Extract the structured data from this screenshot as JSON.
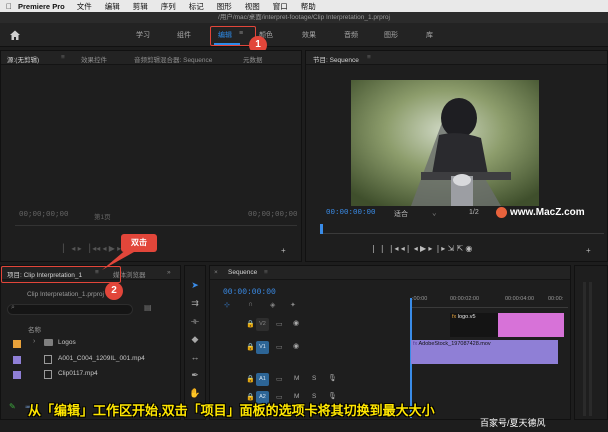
{
  "menubar": {
    "app": "Premiere Pro",
    "items": [
      "文件",
      "编辑",
      "剪辑",
      "序列",
      "标记",
      "图形",
      "视图",
      "窗口",
      "帮助"
    ]
  },
  "window": {
    "path": "/用户/mac/桌面/interpret-footage/Clip Interpretation_1.prproj"
  },
  "workspaces": {
    "items": [
      "学习",
      "组件",
      "编辑",
      "颜色",
      "效果",
      "音频",
      "图形",
      "库"
    ],
    "active": "编辑"
  },
  "source_panel": {
    "tabs": [
      "源:(无剪辑)",
      "效果控件",
      "音频剪辑混合器: Sequence",
      "元数据"
    ],
    "timecode_left": "00;00;00;00",
    "page": "第1页",
    "timecode_right": "00;00;00;00"
  },
  "program_panel": {
    "title": "节目: Sequence",
    "timecode": "00:00:00:00",
    "fit": "适合",
    "resolution": "1/2",
    "timecode_right": "00:00:05:00"
  },
  "project_panel": {
    "tab": "项目: Clip Interpretation_1",
    "tab2": "媒体浏览器",
    "file": "Clip Interpretation_1.prproj",
    "col_name": "名称",
    "items": [
      {
        "name": "Logos",
        "color": "#e8a13a",
        "type": "folder"
      },
      {
        "name": "A001_C004_1209IL_001.mp4",
        "color": "#8f7fd6",
        "type": "clip"
      },
      {
        "name": "Clip0117.mp4",
        "color": "#8f7fd6",
        "type": "clip"
      }
    ]
  },
  "timeline": {
    "tab": "Sequence",
    "timecode": "00:00:00:00",
    "ruler": [
      ":00:00",
      "00:00:02:00",
      "00:00:04:00",
      "00:00:"
    ],
    "tracks": [
      {
        "label": "V2",
        "clip": "logo.v5"
      },
      {
        "label": "V1",
        "clip": "AdobeStock_197087428.mov"
      },
      {
        "label": "A1"
      },
      {
        "label": "A2"
      }
    ],
    "track_letters": {
      "mute": "M",
      "solo": "S"
    }
  },
  "annotations": {
    "step1": "1",
    "step2": "2",
    "dblclick": "双击",
    "caption": "从「编辑」工作区开始,双击「项目」面板的选项卡将其切换到最大大小"
  },
  "watermark": {
    "site": "www.MacZ.com",
    "footer": "百家号/夏天德风"
  },
  "colors": {
    "accent": "#2d8ceb",
    "annotation": "#e2463a",
    "caption": "#ffe600",
    "video_clip": "#8f7fd6",
    "logo_clip": "#d772d8"
  }
}
